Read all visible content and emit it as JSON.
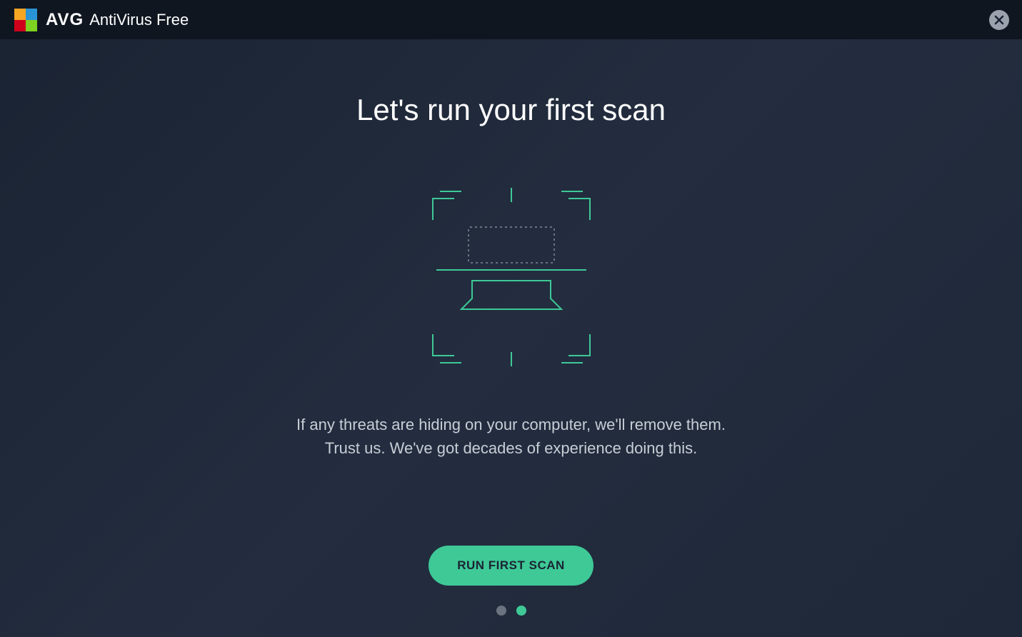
{
  "titlebar": {
    "brand": "AVG",
    "product": "AntiVirus Free",
    "close_icon": "close-icon"
  },
  "main": {
    "heading": "Let's run your first scan",
    "description_line1": "If any threats are hiding on your computer, we'll remove them.",
    "description_line2": "Trust us. We've got decades of experience doing this.",
    "cta_label": "RUN FIRST SCAN"
  },
  "pagination": {
    "total": 2,
    "active_index": 1
  },
  "colors": {
    "accent": "#3ec997",
    "background_dark": "#1a2332",
    "text_primary": "#ffffff",
    "text_secondary": "#c8ced6"
  }
}
